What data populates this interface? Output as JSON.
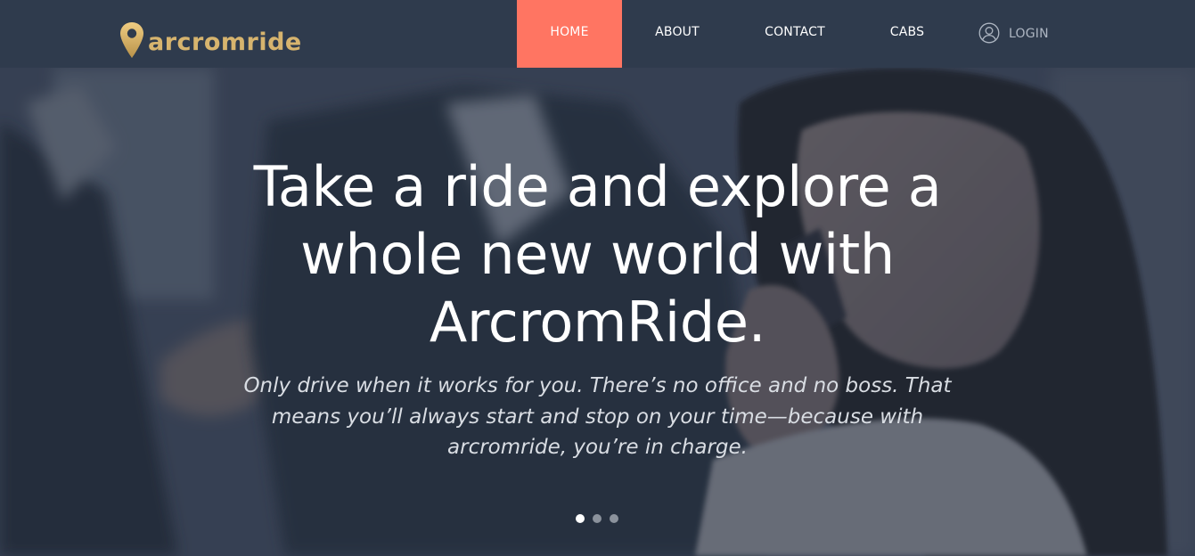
{
  "brand": {
    "name": "arcromride",
    "logo_icon": "map-pin-icon",
    "color": "#d7b46e"
  },
  "nav": {
    "active_color": "#ff7562",
    "items": [
      {
        "label": "HOME",
        "active": true
      },
      {
        "label": "ABOUT",
        "active": false
      },
      {
        "label": "CONTACT",
        "active": false
      },
      {
        "label": "CABS",
        "active": false
      }
    ],
    "login": {
      "label": "LOGIN",
      "icon": "user-circle-icon"
    }
  },
  "hero": {
    "headline_lines": [
      "Take a ride and explore a",
      "whole new world with",
      "ArcromRide."
    ],
    "subtext_lines": [
      "Only drive when it works for you. There’s no office and no boss. That",
      "means you’ll always start and stop on your time—because with",
      "arcromride, you’re in charge."
    ],
    "slides": {
      "count": 3,
      "active_index": 0
    }
  }
}
